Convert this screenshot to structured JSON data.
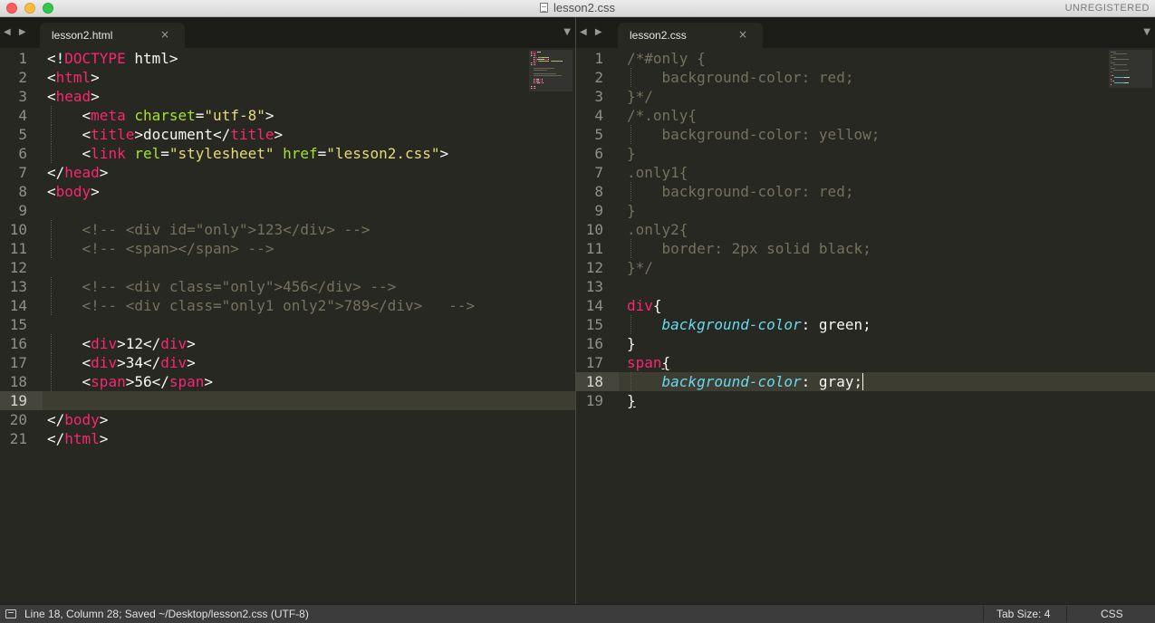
{
  "window": {
    "title": "lesson2.css",
    "registration": "UNREGISTERED"
  },
  "colors": {
    "background": "#272822",
    "tag": "#f92672",
    "attribute": "#a6e22e",
    "string": "#e6db74",
    "comment": "#75715e",
    "property": "#66d9ef"
  },
  "left_pane": {
    "nav": "◀ ▶",
    "tab_label": "lesson2.html",
    "tab_close": "×",
    "dropdown": "▼",
    "active_line": 19,
    "lines": [
      [
        {
          "c": "p",
          "t": "<!"
        },
        {
          "c": "tag",
          "t": "DOCTYPE"
        },
        {
          "c": "p",
          "t": " html>"
        }
      ],
      [
        {
          "c": "p",
          "t": "<"
        },
        {
          "c": "tag",
          "t": "html"
        },
        {
          "c": "p",
          "t": ">"
        }
      ],
      [
        {
          "c": "p",
          "t": "<"
        },
        {
          "c": "tag",
          "t": "head"
        },
        {
          "c": "p",
          "t": ">"
        }
      ],
      [
        {
          "c": "p",
          "t": "    <"
        },
        {
          "c": "tag",
          "t": "meta"
        },
        {
          "c": "p",
          "t": " "
        },
        {
          "c": "attr",
          "t": "charset"
        },
        {
          "c": "p",
          "t": "="
        },
        {
          "c": "str",
          "t": "\"utf-8\""
        },
        {
          "c": "p",
          "t": ">"
        }
      ],
      [
        {
          "c": "p",
          "t": "    <"
        },
        {
          "c": "tag",
          "t": "title"
        },
        {
          "c": "p",
          "t": ">document</"
        },
        {
          "c": "tag",
          "t": "title"
        },
        {
          "c": "p",
          "t": ">"
        }
      ],
      [
        {
          "c": "p",
          "t": "    <"
        },
        {
          "c": "tag",
          "t": "link"
        },
        {
          "c": "p",
          "t": " "
        },
        {
          "c": "attr",
          "t": "rel"
        },
        {
          "c": "p",
          "t": "="
        },
        {
          "c": "str",
          "t": "\"stylesheet\""
        },
        {
          "c": "p",
          "t": " "
        },
        {
          "c": "attr",
          "t": "href"
        },
        {
          "c": "p",
          "t": "="
        },
        {
          "c": "str",
          "t": "\"lesson2.css\""
        },
        {
          "c": "p",
          "t": ">"
        }
      ],
      [
        {
          "c": "p",
          "t": "</"
        },
        {
          "c": "tag",
          "t": "head"
        },
        {
          "c": "p",
          "t": ">"
        }
      ],
      [
        {
          "c": "p",
          "t": "<"
        },
        {
          "c": "tag",
          "t": "body"
        },
        {
          "c": "p",
          "t": ">"
        }
      ],
      [],
      [
        {
          "c": "cmt",
          "t": "    <!-- <div id=\"only\">123</div> -->"
        }
      ],
      [
        {
          "c": "cmt",
          "t": "    <!-- <span></span> -->"
        }
      ],
      [],
      [
        {
          "c": "cmt",
          "t": "    <!-- <div class=\"only\">456</div> -->"
        }
      ],
      [
        {
          "c": "cmt",
          "t": "    <!-- <div class=\"only1 only2\">789</div>   -->"
        }
      ],
      [],
      [
        {
          "c": "p",
          "t": "    <"
        },
        {
          "c": "tag",
          "t": "div"
        },
        {
          "c": "p",
          "t": ">12</"
        },
        {
          "c": "tag",
          "t": "div"
        },
        {
          "c": "p",
          "t": ">"
        }
      ],
      [
        {
          "c": "p",
          "t": "    <"
        },
        {
          "c": "tag",
          "t": "div"
        },
        {
          "c": "p",
          "t": ">34</"
        },
        {
          "c": "tag",
          "t": "div"
        },
        {
          "c": "p",
          "t": ">"
        }
      ],
      [
        {
          "c": "p",
          "t": "    <"
        },
        {
          "c": "tag",
          "t": "span"
        },
        {
          "c": "p",
          "t": ">56</"
        },
        {
          "c": "tag",
          "t": "span"
        },
        {
          "c": "p",
          "t": ">"
        }
      ],
      [],
      [
        {
          "c": "p",
          "t": "</"
        },
        {
          "c": "tag",
          "t": "body"
        },
        {
          "c": "p",
          "t": ">"
        }
      ],
      [
        {
          "c": "p",
          "t": "</"
        },
        {
          "c": "tag",
          "t": "html"
        },
        {
          "c": "p",
          "t": ">"
        }
      ]
    ]
  },
  "right_pane": {
    "nav": "◀ ▶",
    "tab_label": "lesson2.css",
    "tab_close": "×",
    "dropdown": "▼",
    "active_line": 18,
    "lines": [
      [
        {
          "c": "cmt",
          "t": "/*#only {"
        }
      ],
      [
        {
          "c": "cmt",
          "t": "    background-color: red;"
        }
      ],
      [
        {
          "c": "cmt",
          "t": "}*/"
        }
      ],
      [
        {
          "c": "cmt",
          "t": "/*.only{"
        }
      ],
      [
        {
          "c": "cmt",
          "t": "    background-color: yellow;"
        }
      ],
      [
        {
          "c": "cmt",
          "t": "}"
        }
      ],
      [
        {
          "c": "cmt",
          "t": ".only1{"
        }
      ],
      [
        {
          "c": "cmt",
          "t": "    background-color: red;"
        }
      ],
      [
        {
          "c": "cmt",
          "t": "}"
        }
      ],
      [
        {
          "c": "cmt",
          "t": ".only2{"
        }
      ],
      [
        {
          "c": "cmt",
          "t": "    border: 2px solid black;"
        }
      ],
      [
        {
          "c": "cmt",
          "t": "}*/"
        }
      ],
      [],
      [
        {
          "c": "tag",
          "t": "div"
        },
        {
          "c": "p",
          "t": "{"
        }
      ],
      [
        {
          "c": "p",
          "t": "    "
        },
        {
          "c": "prop",
          "t": "background-color"
        },
        {
          "c": "p",
          "t": ": "
        },
        {
          "c": "prop-v",
          "t": "green"
        },
        {
          "c": "p",
          "t": ";"
        }
      ],
      [
        {
          "c": "p",
          "t": "}"
        }
      ],
      [
        {
          "c": "tag",
          "t": "span"
        },
        {
          "c": "brace",
          "t": "{"
        }
      ],
      [
        {
          "c": "p",
          "t": "    "
        },
        {
          "c": "prop",
          "t": "background-color"
        },
        {
          "c": "p",
          "t": ": "
        },
        {
          "c": "prop-v",
          "t": "gray"
        },
        {
          "c": "p",
          "t": ";"
        },
        {
          "c": "caret",
          "t": ""
        }
      ],
      [
        {
          "c": "brace",
          "t": "}"
        }
      ]
    ]
  },
  "statusbar": {
    "message": "Line 18, Column 28; Saved ~/Desktop/lesson2.css (UTF-8)",
    "tab_size": "Tab Size: 4",
    "syntax": "CSS"
  }
}
